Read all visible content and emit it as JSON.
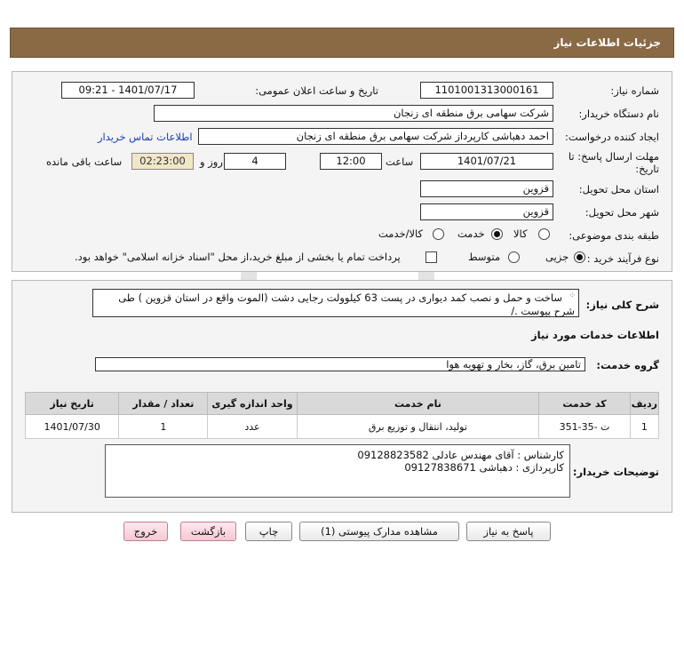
{
  "page_title": "جزئیات اطلاعات نیاز",
  "fields": {
    "need_number_label": "شماره نیاز:",
    "need_number": "1101001313000161",
    "announce_label": "تاریخ و ساعت اعلان عمومی:",
    "announce_value": "1401/07/17 - 09:21",
    "buyer_org_label": "نام دستگاه خریدار:",
    "buyer_org": "شرکت سهامی برق منطقه ای زنجان",
    "requester_label": "ایجاد کننده درخواست:",
    "requester": "احمد دهباشی کارپرداز شرکت سهامی برق منطقه ای زنجان",
    "contact_link": "اطلاعات تماس خریدار",
    "deadline_label_1": "مهلت ارسال پاسخ: تا",
    "deadline_label_2": "تاریخ:",
    "deadline_date": "1401/07/21",
    "hour_label": "ساعت",
    "deadline_time": "12:00",
    "days_value": "4",
    "days_label": "روز و",
    "timer_value": "02:23:00",
    "remaining_label": "ساعت باقی مانده",
    "province_label": "استان محل تحویل:",
    "province": "قزوین",
    "city_label": "شهر محل تحویل:",
    "city": "قزوین",
    "category_label": "طبقه بندی موضوعی:",
    "category_options": [
      "کالا",
      "خدمت",
      "کالا/خدمت"
    ],
    "purchase_type_label": "نوع فرآیند خرید :",
    "purchase_options": [
      "جزیی",
      "متوسط"
    ],
    "payment_note": "پرداخت تمام یا بخشی از مبلغ خرید،از محل \"اسناد خزانه اسلامی\" خواهد بود."
  },
  "description": {
    "label": "شرح کلی نیاز:",
    "text_line1": "ساخت و حمل و نصب کمد دیواری در پست 63 کیلوولت رجایی دشت (الموت واقع در استان قزوین ) طی",
    "text_line2": "شرح پیوست ./"
  },
  "services": {
    "section_title": "اطلاعات خدمات مورد نیاز",
    "group_label": "گروه خدمت:",
    "group_value": "تامین برق، گاز، بخار و تهویه هوا",
    "columns": [
      "ردیف",
      "کد خدمت",
      "نام خدمت",
      "واحد اندازه گیری",
      "تعداد / مقدار",
      "تاریخ نیاز"
    ],
    "rows": [
      {
        "row": "1",
        "code": "ت -35-351",
        "name": "تولید، انتقال و توزیع برق",
        "unit": "عدد",
        "qty": "1",
        "date": "1401/07/30"
      }
    ]
  },
  "buyer_notes": {
    "label": "توضیحات خریدار:",
    "line1": "کارشناس : آقای مهندس عادلی 09128823582",
    "line2": "کارپردازی : دهباشی 09127838671"
  },
  "buttons": {
    "reply": "پاسخ به نیاز",
    "attachments": "مشاهده مدارک پیوستی (1)",
    "print": "چاپ",
    "back": "بازگشت",
    "exit": "خروج"
  },
  "watermark_text": "ParsNamadData"
}
